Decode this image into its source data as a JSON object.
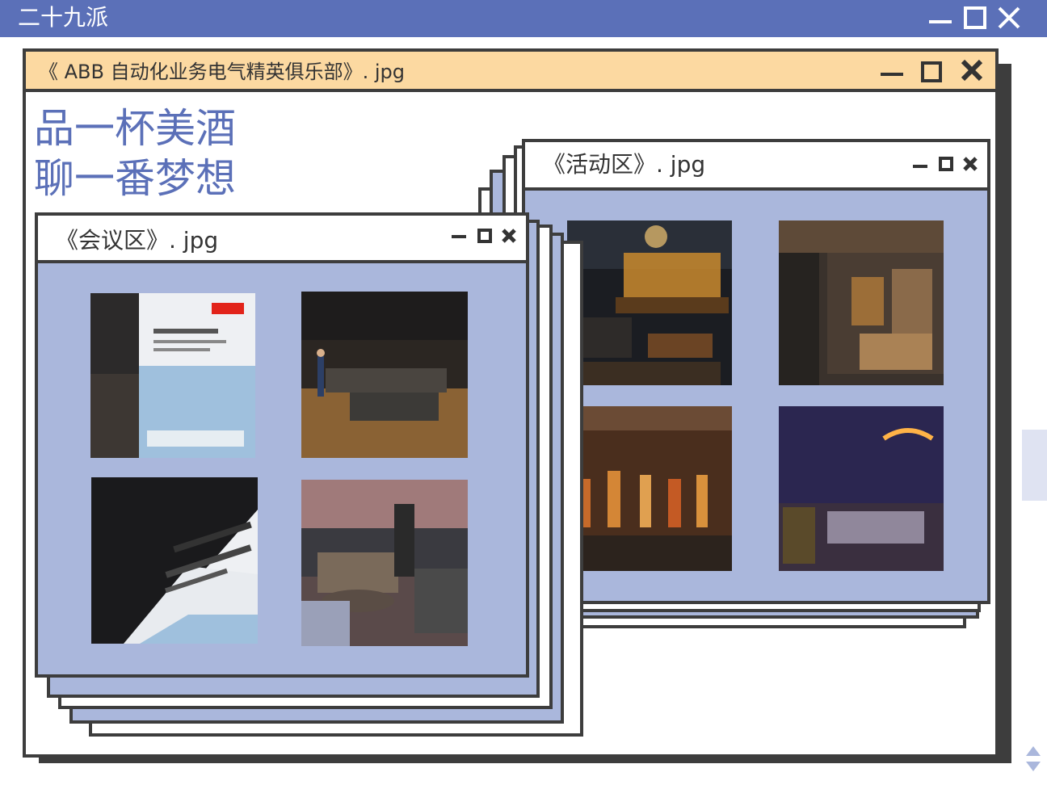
{
  "app": {
    "title": "二十九派"
  },
  "main_window": {
    "title": "《 ABB 自动化业务电气精英俱乐部》. jpg",
    "slogan_lines": [
      "品一杯美酒",
      "聊一番梦想"
    ]
  },
  "meeting_window": {
    "title": "《会议区》. jpg",
    "photos": [
      "banner-display",
      "meeting-room",
      "banner-closeup",
      "lounge-armor"
    ]
  },
  "activity_window": {
    "title": "《活动区》. jpg",
    "photos": [
      "bar-lounge",
      "wine-wall-corridor",
      "liquor-shelf",
      "neon-bar"
    ]
  },
  "icons": {
    "minimize": "minimize-icon",
    "maximize": "maximize-icon",
    "close": "close-icon"
  },
  "colors": {
    "accent": "#5b70b8",
    "title_bar": "#fcd9a1",
    "panel": "#aab7dc",
    "frame": "#3d3d3d"
  }
}
